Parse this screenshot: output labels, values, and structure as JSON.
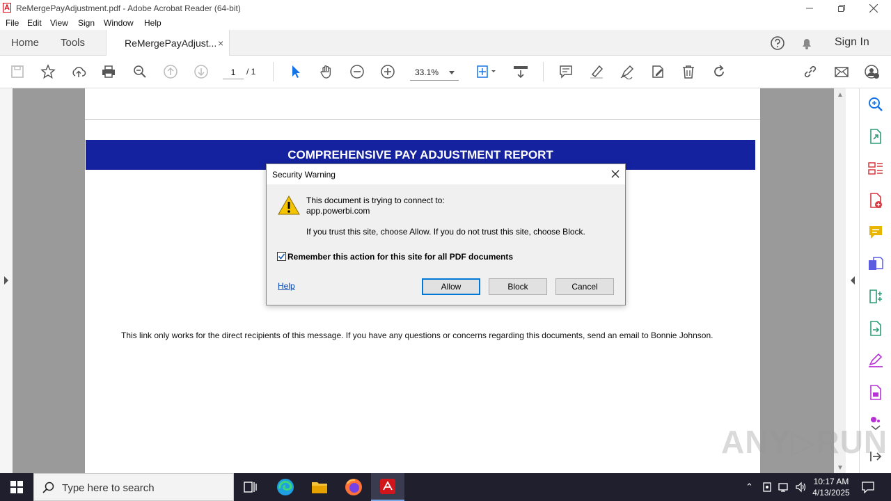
{
  "window": {
    "title": "ReMergePayAdjustment.pdf - Adobe Acrobat Reader (64-bit)"
  },
  "menu": [
    "File",
    "Edit",
    "View",
    "Sign",
    "Window",
    "Help"
  ],
  "tabs": {
    "home": "Home",
    "tools": "Tools",
    "document": "ReMergePayAdjust...",
    "close": "×",
    "sign_in": "Sign In"
  },
  "toolbar": {
    "page_current": "1",
    "page_total": "/ 1",
    "zoom": "33.1%"
  },
  "document": {
    "banner": "COMPREHENSIVE PAY ADJUSTMENT REPORT",
    "footnote": "This link only works for the direct recipients of this message. If you have any questions or concerns regarding this documents, send an email to Bonnie Johnson."
  },
  "dialog": {
    "title": "Security Warning",
    "line1": "This document is trying to connect to:",
    "host": "app.powerbi.com",
    "line2": "If you trust this site, choose Allow. If you do not trust this site, choose Block.",
    "remember_label": "Remember this action for this site for all PDF documents",
    "remember_checked": true,
    "help": "Help",
    "allow": "Allow",
    "block": "Block",
    "cancel": "Cancel"
  },
  "taskbar": {
    "search_placeholder": "Type here to search",
    "time": "10:17 AM",
    "date": "4/13/2025"
  },
  "watermark": "ANY RUN",
  "colors": {
    "banner": "#1522a0",
    "accent": "#1473e6",
    "taskbar": "#1f1f2e"
  }
}
